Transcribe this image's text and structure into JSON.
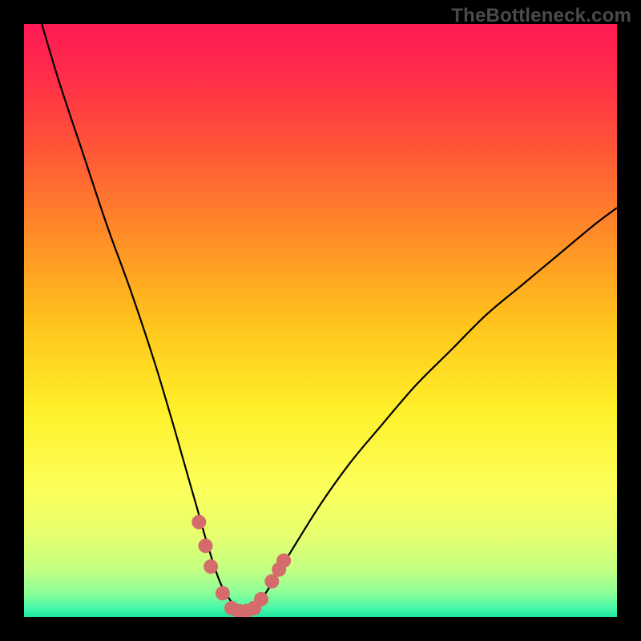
{
  "watermark": "TheBottleneck.com",
  "colors": {
    "frame": "#000000",
    "gradient_stops": [
      {
        "offset": 0.0,
        "color": "#ff1a55"
      },
      {
        "offset": 0.08,
        "color": "#ff2b4a"
      },
      {
        "offset": 0.2,
        "color": "#ff5238"
      },
      {
        "offset": 0.35,
        "color": "#ff8a28"
      },
      {
        "offset": 0.5,
        "color": "#ffc21c"
      },
      {
        "offset": 0.65,
        "color": "#fff02a"
      },
      {
        "offset": 0.78,
        "color": "#fcff5a"
      },
      {
        "offset": 0.86,
        "color": "#e8ff6e"
      },
      {
        "offset": 0.92,
        "color": "#c4ff82"
      },
      {
        "offset": 0.96,
        "color": "#8bff98"
      },
      {
        "offset": 0.985,
        "color": "#46f7a8"
      },
      {
        "offset": 1.0,
        "color": "#1de9a0"
      }
    ],
    "curve": "#000000",
    "marker": "#d66b6b"
  },
  "chart_data": {
    "type": "line",
    "title": "",
    "xlabel": "",
    "ylabel": "",
    "xlim": [
      0,
      100
    ],
    "ylim": [
      0,
      100
    ],
    "grid": false,
    "legend": false,
    "series": [
      {
        "name": "bottleneck-curve",
        "x": [
          3,
          6,
          10,
          14,
          18,
          22,
          25,
          27,
          29,
          31,
          33,
          35,
          36.5,
          38,
          40,
          42,
          45,
          50,
          55,
          60,
          66,
          72,
          78,
          84,
          90,
          96,
          100
        ],
        "y": [
          100,
          90,
          78,
          66,
          55,
          43,
          33,
          26,
          19,
          12,
          6,
          2.5,
          1.2,
          1.2,
          3,
          6,
          11,
          19,
          26,
          32,
          39,
          45,
          51,
          56,
          61,
          66,
          69
        ]
      }
    ],
    "markers": {
      "name": "highlight-range",
      "x": [
        29.5,
        30.6,
        31.5,
        33.5,
        35.0,
        36.2,
        37.5,
        38.8,
        40.0,
        41.8,
        43.0,
        43.8
      ],
      "y": [
        16.0,
        12.0,
        8.5,
        4.0,
        1.5,
        1.0,
        1.0,
        1.5,
        3.0,
        6.0,
        8.0,
        9.5
      ]
    }
  }
}
